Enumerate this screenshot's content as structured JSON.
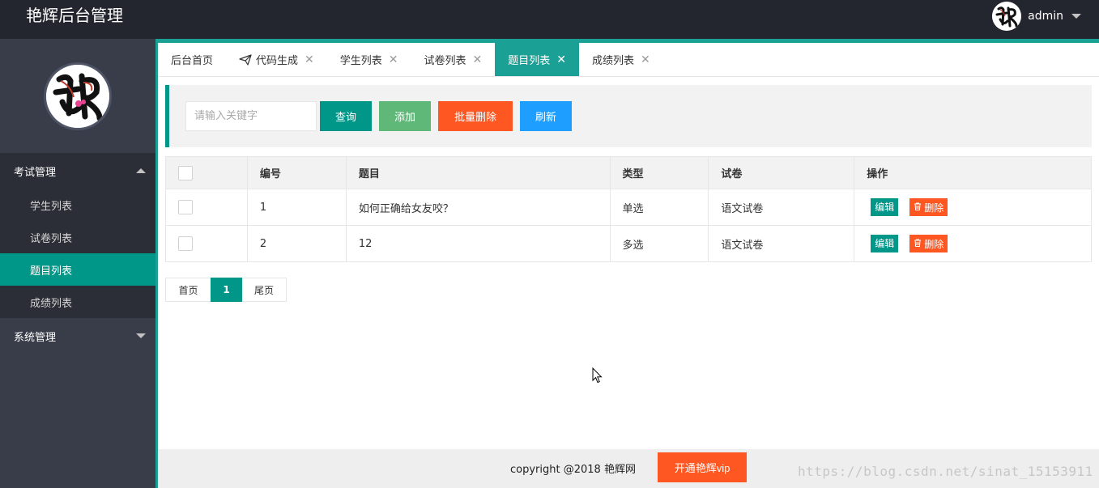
{
  "header": {
    "title": "艳辉后台管理",
    "user_name": "admin"
  },
  "sidebar": {
    "groups": [
      {
        "label": "考试管理",
        "items": [
          {
            "label": "学生列表"
          },
          {
            "label": "试卷列表"
          },
          {
            "label": "题目列表"
          },
          {
            "label": "成绩列表"
          }
        ]
      },
      {
        "label": "系统管理"
      }
    ]
  },
  "tabs": [
    {
      "label": "后台首页"
    },
    {
      "label": "代码生成"
    },
    {
      "label": "学生列表"
    },
    {
      "label": "试卷列表"
    },
    {
      "label": "题目列表"
    },
    {
      "label": "成绩列表"
    }
  ],
  "toolbar": {
    "search_placeholder": "请输入关键字",
    "query_label": "查询",
    "add_label": "添加",
    "batch_delete_label": "批量删除",
    "refresh_label": "刷新"
  },
  "table": {
    "columns": [
      "编号",
      "题目",
      "类型",
      "试卷",
      "操作"
    ],
    "rows": [
      {
        "id": "1",
        "question": "如何正确给女友咬？",
        "type": "单选",
        "paper": "语文试卷"
      },
      {
        "id": "2",
        "question": "12",
        "type": "多选",
        "paper": "语文试卷"
      }
    ],
    "edit_label": "编辑",
    "delete_label": "删除"
  },
  "pager": {
    "first": "首页",
    "current": "1",
    "last": "尾页"
  },
  "footer": {
    "copyright": "copyright @2018 艳辉网",
    "vip_label": "开通艳辉vip"
  },
  "watermark": "https://blog.csdn.net/sinat_15153911",
  "colors": {
    "accent": "#009688",
    "danger": "#ff5722",
    "success": "#5fb878",
    "info": "#1e9fff",
    "header_bg": "#23262e",
    "sidebar_bg": "#393d49"
  }
}
